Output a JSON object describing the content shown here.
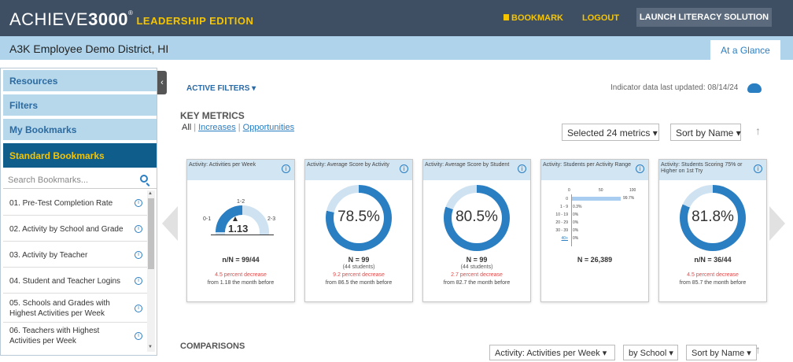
{
  "header": {
    "brand_main": "ACHIEVE",
    "brand_bold": "3000",
    "brand_reg": "®",
    "brand_edition": "LEADERSHIP EDITION",
    "bookmark": "BOOKMARK",
    "logout": "LOGOUT",
    "launch": "LAUNCH LITERACY SOLUTION"
  },
  "district": {
    "name": "A3K Employee Demo District, HI",
    "tab": "At a Glance"
  },
  "sidebar": {
    "sections": [
      "Resources",
      "Filters",
      "My Bookmarks",
      "Standard Bookmarks"
    ],
    "search_placeholder": "Search Bookmarks...",
    "items": [
      {
        "label": "01. Pre-Test Completion Rate"
      },
      {
        "label": "02. Activity by School and Grade"
      },
      {
        "label": "03. Activity by Teacher"
      },
      {
        "label": "04. Student and Teacher Logins"
      },
      {
        "label": "05. Schools and Grades with Highest Activities per Week"
      },
      {
        "label": "06. Teachers with Highest Activities per Week"
      }
    ],
    "info_glyph": "i"
  },
  "main": {
    "active_filters": "ACTIVE FILTERS ▾",
    "updated": "Indicator data last updated: 08/14/24",
    "key_metrics": "KEY METRICS",
    "tabs": {
      "all": "All",
      "increases": "Increases",
      "opportunities": "Opportunities"
    },
    "selected": "Selected 24 metrics ▾",
    "sort": "Sort by Name ▾",
    "comparisons": "COMPARISONS",
    "comp_dd1": "Activity: Activities per Week ▾",
    "comp_dd2": "by School ▾",
    "comp_dd3": "Sort by Name ▾"
  },
  "cards": [
    {
      "title": "Activity: Activities per Week",
      "gauge": {
        "labels": [
          "0-1",
          "1-2",
          "2-3"
        ],
        "value": "1.13"
      },
      "n": "n/N = 99/44",
      "decrease": "4.5 percent decrease",
      "from": "from 1.18 the month before"
    },
    {
      "title": "Activity: Average Score by Activity",
      "pct": "78.5%",
      "pct_value": 78.5,
      "n": "N = 99",
      "nsub": "(44 students)",
      "decrease": "9.2 percent decrease",
      "from": "from 86.5 the month before"
    },
    {
      "title": "Activity: Average Score by Student",
      "pct": "80.5%",
      "pct_value": 80.5,
      "n": "N = 99",
      "nsub": "(44 students)",
      "decrease": "2.7 percent decrease",
      "from": "from 82.7 the month before"
    },
    {
      "title": "Activity: Students per Activity Range",
      "hist": {
        "axis": [
          "0",
          "50",
          "100"
        ],
        "rows": [
          {
            "range": "0",
            "val": "99.7%"
          },
          {
            "range": "1 - 9",
            "val": "0.3%"
          },
          {
            "range": "10 - 19",
            "val": "0%"
          },
          {
            "range": "20 - 29",
            "val": "0%"
          },
          {
            "range": "30 - 39",
            "val": "0%"
          },
          {
            "range": "40+",
            "val": "0%"
          }
        ]
      },
      "n": "N = 26,389"
    },
    {
      "title": "Activity: Students Scoring 75% or Higher on 1st Try",
      "pct": "81.8%",
      "pct_value": 81.8,
      "n": "n/N = 36/44",
      "decrease": "4.5 percent decrease",
      "from": "from 85.7 the month before"
    }
  ]
}
